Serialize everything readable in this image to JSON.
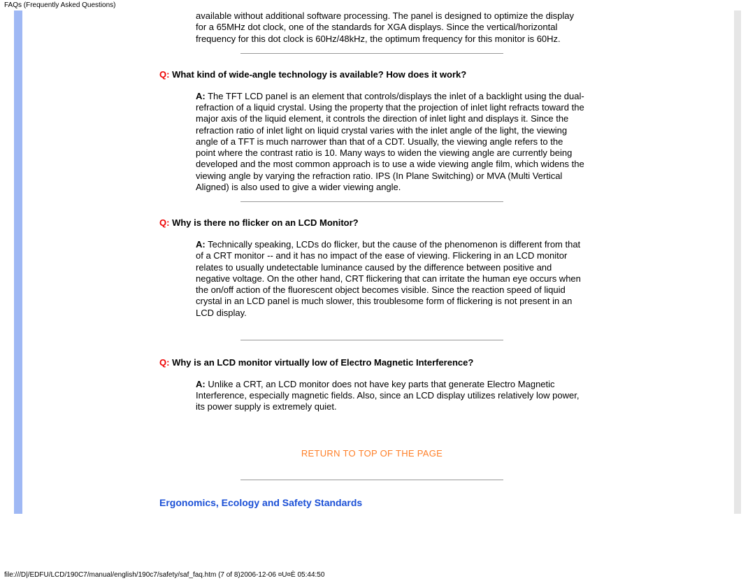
{
  "header": {
    "title": "FAQs (Frequently Asked Questions)"
  },
  "intro_answer": "available without additional software processing. The panel is designed to optimize the display for a 65MHz dot clock, one of the standards for XGA displays. Since the vertical/horizontal frequency for this dot clock is 60Hz/48kHz, the optimum frequency for this monitor is 60Hz.",
  "faqs": [
    {
      "q_label": "Q:",
      "question": "What kind of wide-angle technology is available? How does it work?",
      "a_label": "A:",
      "answer": "The TFT LCD panel is an element that controls/displays the inlet of a backlight using the dual-refraction of a liquid crystal. Using the property that the projection of inlet light refracts toward the major axis of the liquid element, it controls the direction of inlet light and displays it. Since the refraction ratio of inlet light on liquid crystal varies with the inlet angle of the light, the viewing angle of a TFT is much narrower than that of a CDT. Usually, the viewing angle refers to the point where the contrast ratio is 10. Many ways to widen the viewing angle are currently being developed and the most common approach is to use a wide viewing angle film, which widens the viewing angle by varying the refraction ratio. IPS (In Plane Switching) or MVA (Multi Vertical Aligned) is also used to give a wider viewing angle."
    },
    {
      "q_label": "Q:",
      "question": "Why is there no flicker on an LCD Monitor?",
      "a_label": "A:",
      "answer": "Technically speaking, LCDs do flicker, but the cause of the phenomenon is different from that of a CRT monitor -- and it has no impact of the ease of viewing. Flickering in an LCD monitor relates to usually undetectable luminance caused by the difference between positive and negative voltage. On the other hand, CRT flickering that can irritate the human eye occurs when the on/off action of the fluorescent object becomes visible. Since the reaction speed of liquid crystal in an LCD panel is much slower, this troublesome form of flickering is not present in an LCD display."
    },
    {
      "q_label": "Q:",
      "question": "Why is an LCD monitor virtually low of Electro Magnetic Interference?",
      "a_label": "A:",
      "answer": "Unlike a CRT, an LCD monitor does not have key parts that generate Electro Magnetic Interference, especially magnetic fields. Also, since an LCD display utilizes relatively low power, its power supply is extremely quiet."
    }
  ],
  "return_link": "RETURN TO TOP OF THE PAGE",
  "section_heading": "Ergonomics, Ecology and Safety Standards",
  "footer": {
    "path": "file:///D|/EDFU/LCD/190C7/manual/english/190c7/safety/saf_faq.htm (7 of 8)2006-12-06 ¤U¤È 05:44:50"
  }
}
